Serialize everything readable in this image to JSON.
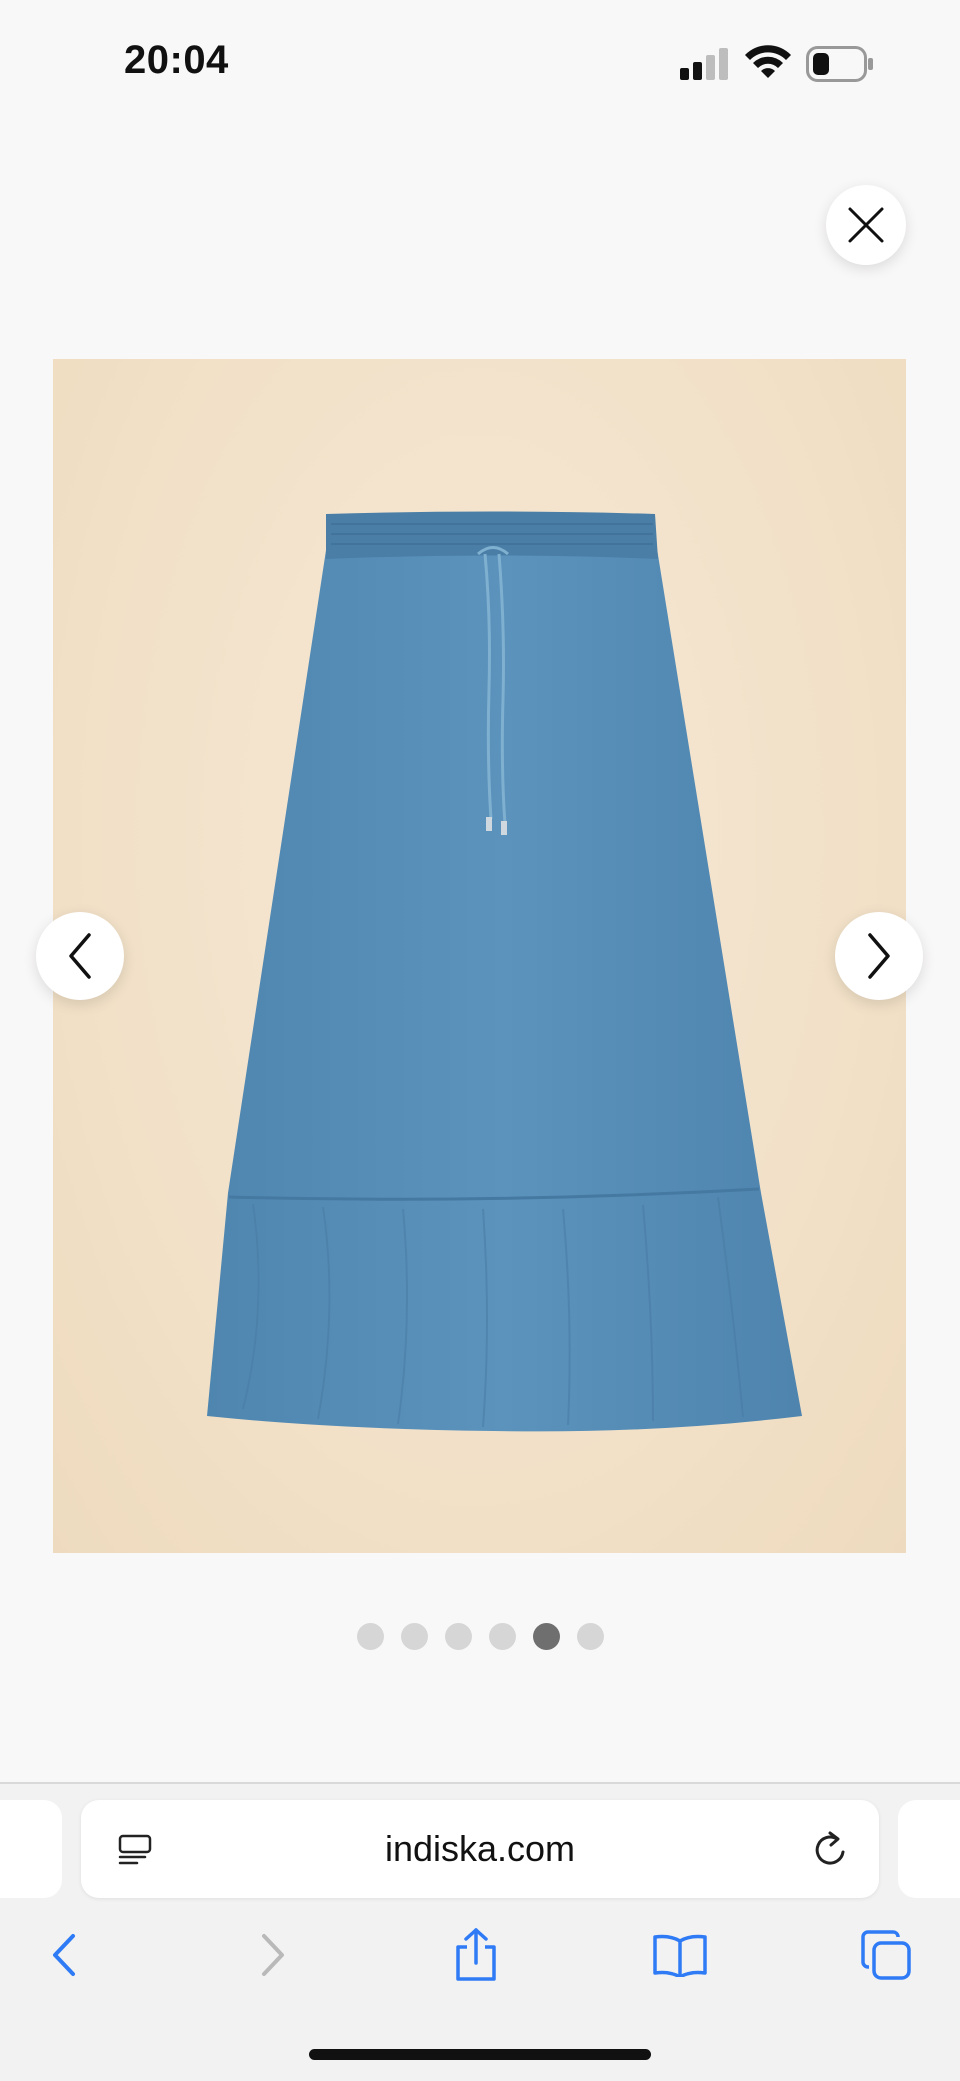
{
  "status_bar": {
    "time": "20:04",
    "icons": [
      "signal-icon",
      "wifi-icon",
      "battery-icon"
    ]
  },
  "viewer": {
    "close_icon": "close-icon",
    "product_image": {
      "subject": "blue-denim-maxi-skirt",
      "background_color": "#f2e1c8",
      "skirt_color": "#5a8fb7"
    },
    "prev_icon": "chevron-left-icon",
    "next_icon": "chevron-right-icon",
    "pagination": {
      "total": 6,
      "active_index": 4
    }
  },
  "browser": {
    "url": "indiska.com",
    "accent_color": "#2f7bf6",
    "toolbar": [
      "back-icon",
      "forward-icon",
      "share-icon",
      "bookmarks-icon",
      "tabs-icon"
    ]
  }
}
